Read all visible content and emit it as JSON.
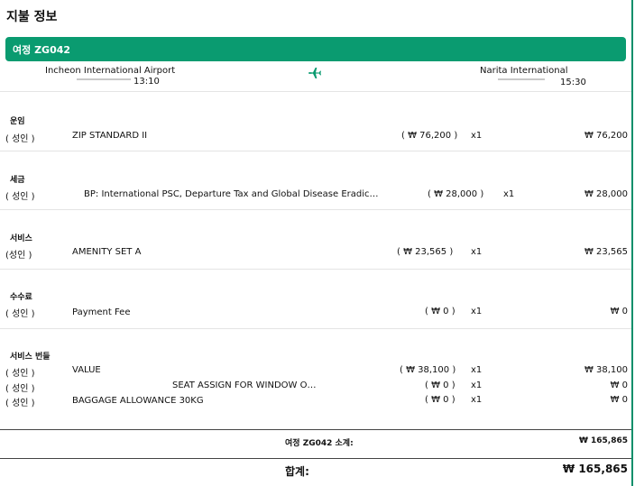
{
  "heading": "지불 정보",
  "trip": {
    "title": "여정 ZG042",
    "origin": {
      "airport": "Incheon International Airport",
      "time": "13:10"
    },
    "destination": {
      "airport": "Narita International",
      "time": "15:30"
    },
    "icon": "airplane-icon"
  },
  "sections": [
    {
      "title": "운임",
      "rows": [
        {
          "pax": "( 성인 )",
          "desc": "ZIP STANDARD II",
          "unit": "( ₩ 76,200 )",
          "qty": "x1",
          "amount": "₩ 76,200"
        }
      ]
    },
    {
      "title": "세금",
      "rows": [
        {
          "pax": "( 성인 )",
          "desc": "BP: International PSC, Departure Tax and Global Disease Eradic…",
          "unit": "( ₩ 28,000 )",
          "qty": "x1",
          "amount": "₩ 28,000"
        }
      ]
    },
    {
      "title": "서비스",
      "rows": [
        {
          "pax": "(성인 )",
          "desc": "AMENITY SET A",
          "unit": "( ₩ 23,565 )",
          "qty": "x1",
          "amount": "₩ 23,565"
        }
      ]
    },
    {
      "title": "수수료",
      "rows": [
        {
          "pax": "( 성인 )",
          "desc": "Payment Fee",
          "unit": "( ₩ 0 )",
          "qty": "x1",
          "amount": "₩ 0"
        }
      ]
    },
    {
      "title": "서비스 번들",
      "rows": [
        {
          "pax": "( 성인 )",
          "desc": "VALUE",
          "unit": "( ₩ 38,100 )",
          "qty": "x1",
          "amount": "₩ 38,100"
        },
        {
          "pax": "( 성인 )",
          "desc": "SEAT ASSIGN FOR WINDOW O…",
          "unit": "( ₩ 0 )",
          "qty": "x1",
          "amount": "₩ 0"
        },
        {
          "pax": "( 성인 )",
          "desc": "BAGGAGE ALLOWANCE 30KG",
          "unit": "( ₩ 0 )",
          "qty": "x1",
          "amount": "₩ 0"
        }
      ]
    }
  ],
  "subtotal": {
    "label": "여정 ZG042 소계:",
    "value": "₩ 165,865"
  },
  "total": {
    "label": "합계:",
    "value": "₩ 165,865"
  },
  "colors": {
    "accent": "#0a9b70"
  }
}
